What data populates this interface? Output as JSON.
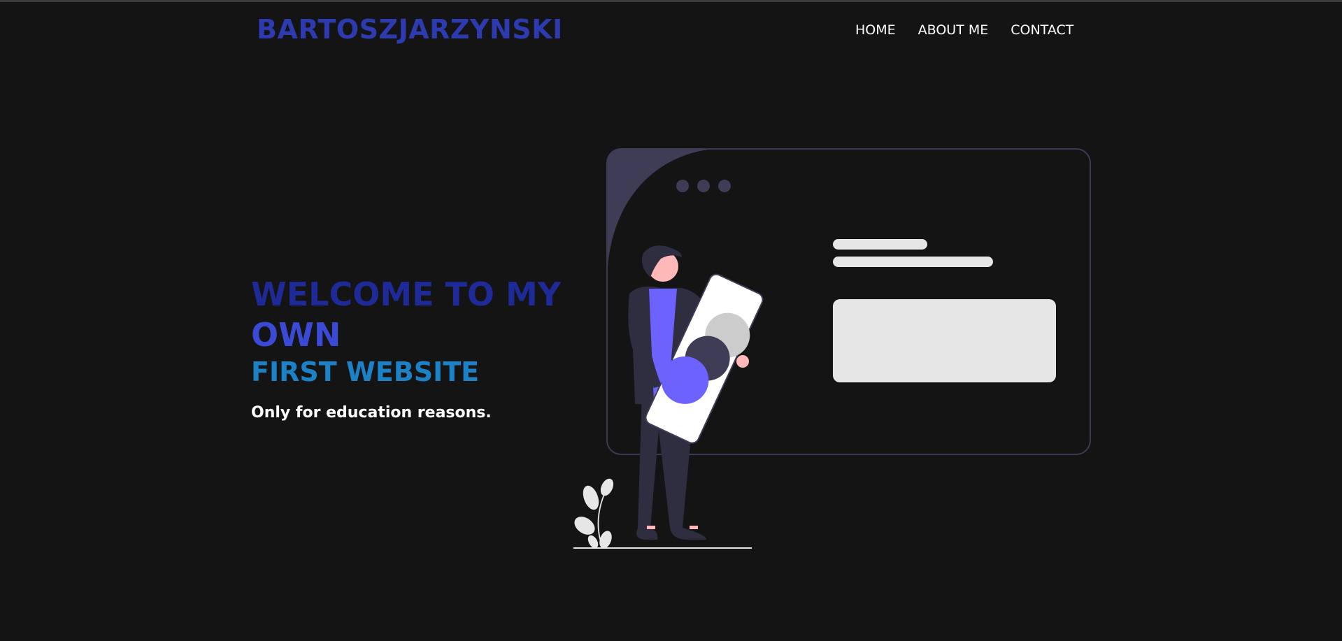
{
  "header": {
    "brand": "BARTOSZJARZYNSKI",
    "nav": [
      {
        "label": "HOME"
      },
      {
        "label": "ABOUT ME"
      },
      {
        "label": "CONTACT"
      }
    ]
  },
  "hero": {
    "title_line1": "WELCOME TO MY",
    "title_line2": "OWN",
    "title_line3": "FIRST WEBSITE",
    "subtitle": "Only for education reasons."
  },
  "colors": {
    "background": "#141414",
    "brand": "#2d3ab0",
    "accent": "#6c63ff",
    "title_dark": "#1f2a99",
    "title_mid": "#3b4ad6",
    "title_light": "#1b82c8"
  },
  "illustration": {
    "icon": "person-holding-phone-illustration"
  }
}
